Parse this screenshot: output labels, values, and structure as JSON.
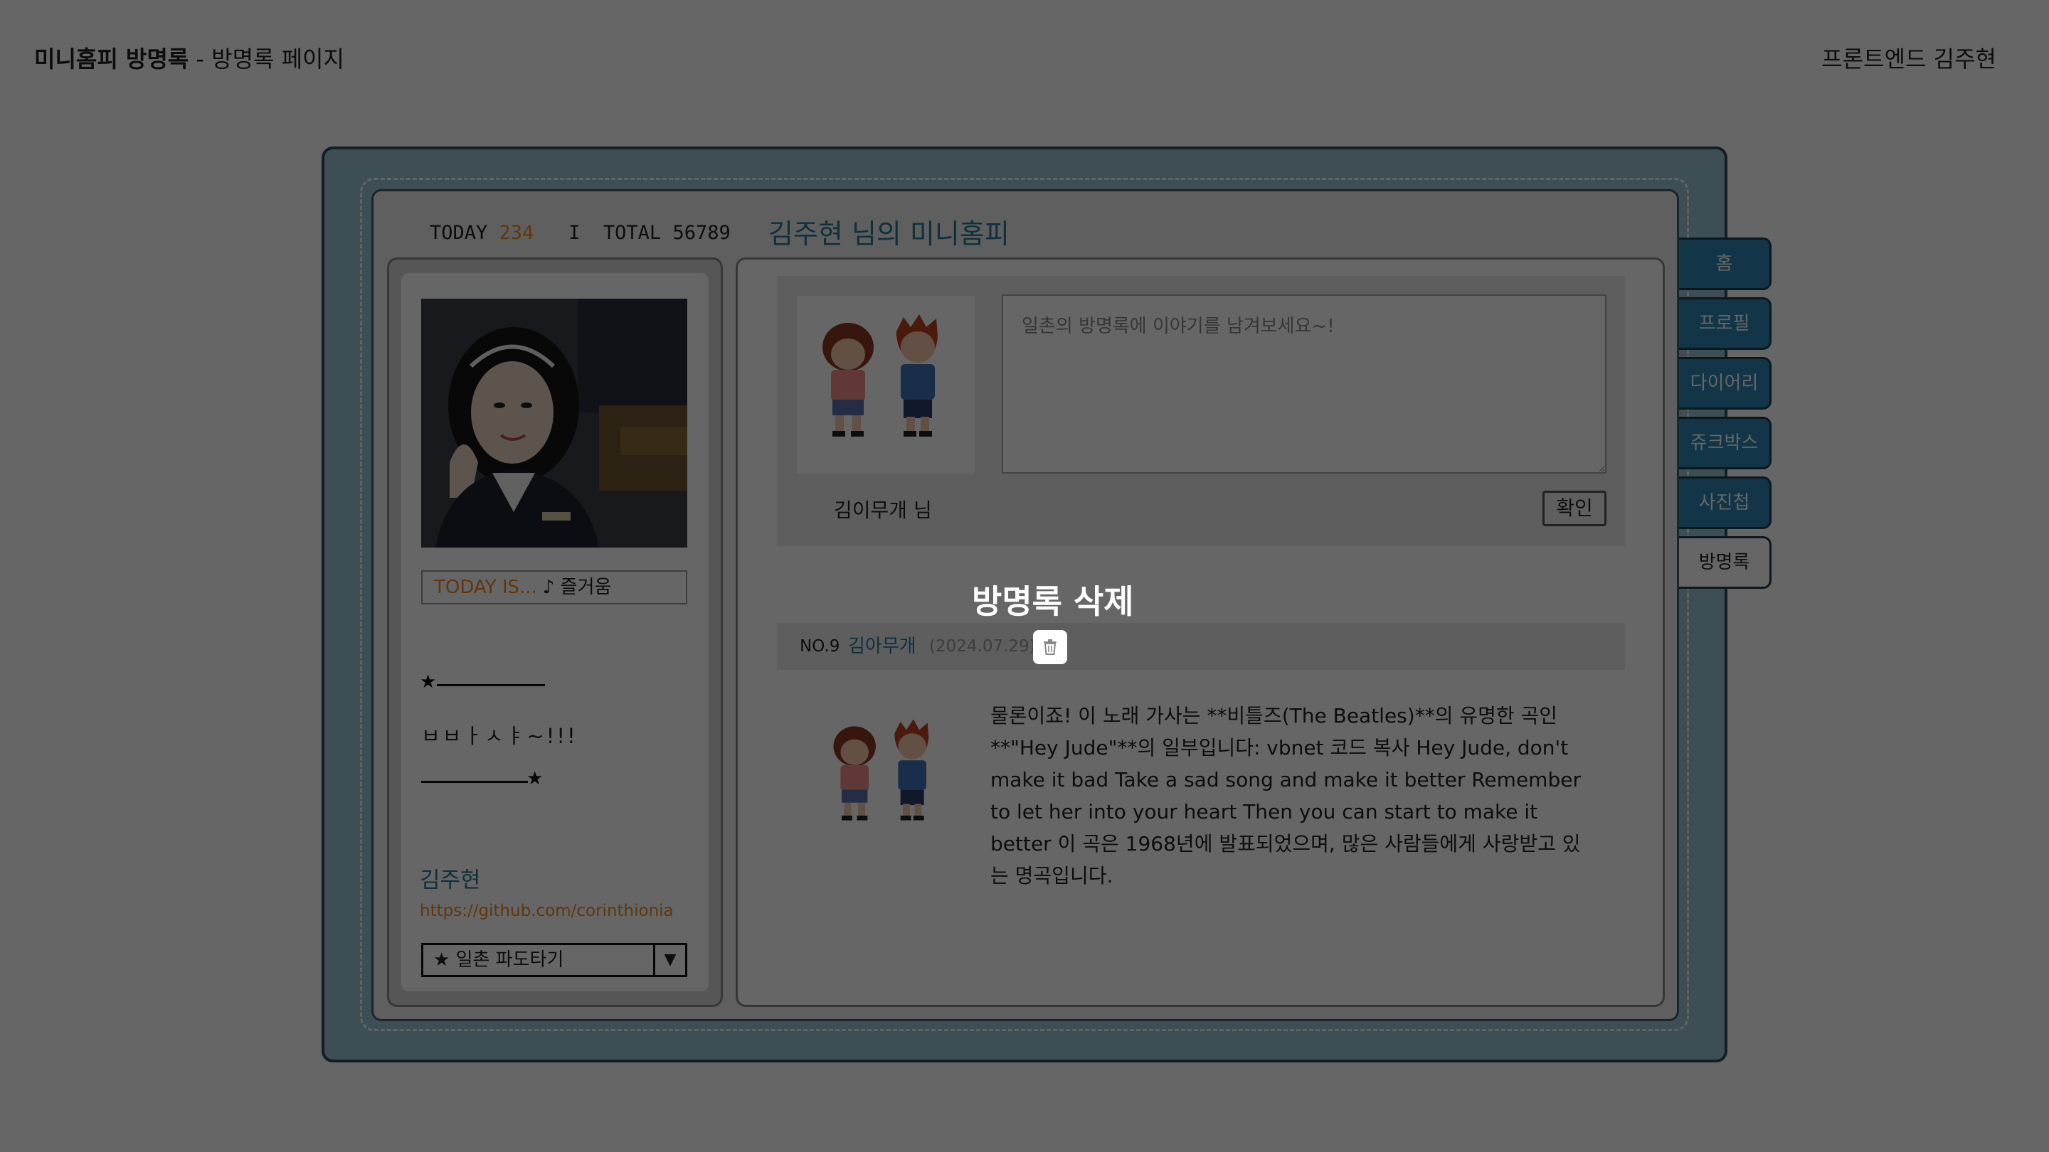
{
  "header": {
    "title_bold": "미니홈피 방명록",
    "title_rest": " - 방명록 페이지",
    "author": "프론트엔드 김주현"
  },
  "counter": {
    "today_label": "TODAY",
    "today_value": "234",
    "separator": "I",
    "total_label": "TOTAL",
    "total_value": "56789"
  },
  "hompy_title": "김주현 님의 미니홈피",
  "profile": {
    "today_is_label": "TODAY IS...",
    "mood": "♪ 즐거움",
    "bbasya": "ㅂㅂㅏㅅㅑ~!!!",
    "name": "김주현",
    "url": "https://github.com/corinthionia",
    "wave_select": "★ 일촌 파도타기",
    "wave_arrow": "▼"
  },
  "write": {
    "placeholder": "일촌의 방명록에 이야기를 남겨보세요~!",
    "writer": "김이무개 님",
    "confirm": "확인"
  },
  "entry": {
    "no": "NO.9",
    "author": "김아무개",
    "date": "(2024.07.29)",
    "content": "물론이죠! 이 노래 가사는 **비틀즈(The Beatles)**의 유명한 곡인 **\"Hey Jude\"**의 일부입니다: vbnet 코드 복사 Hey Jude, don't make it bad Take a sad song and make it better Remember to let her into your heart Then you can start to make it better 이 곡은 1968년에 발표되었으며, 많은 사람들에게 사랑받고 있는 명곡입니다."
  },
  "tabs": [
    "홈",
    "프로필",
    "다이어리",
    "쥬크박스",
    "사진첩",
    "방명록"
  ],
  "active_tab": "방명록",
  "tooltip": "방명록 삭제",
  "colors": {
    "accent_blue": "#27789a",
    "accent_orange": "#f08a24",
    "frame_blue": "#9ac5d3",
    "tab_blue": "#2e86b5"
  }
}
